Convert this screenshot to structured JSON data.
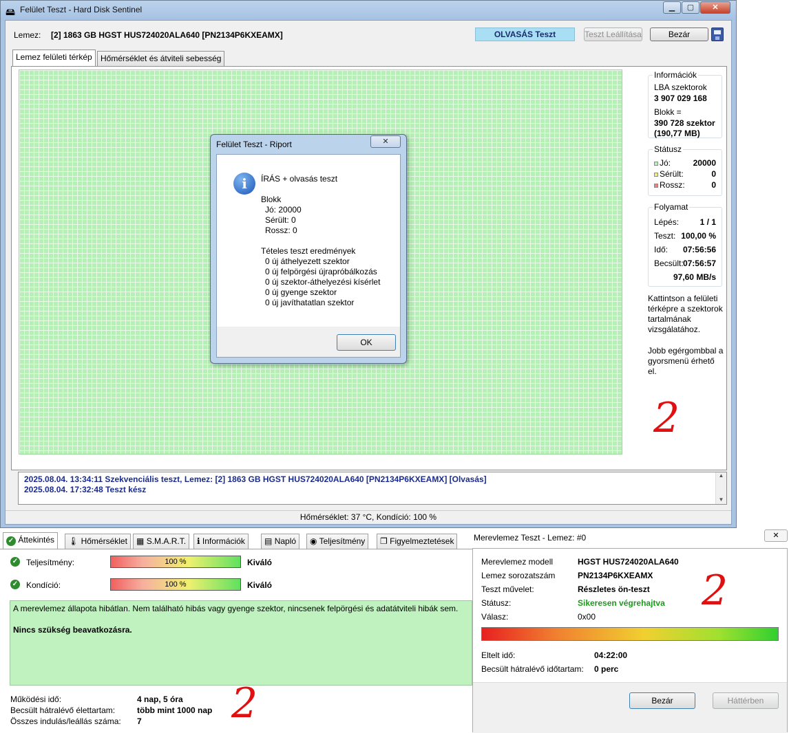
{
  "main_window": {
    "title": "Felület Teszt - Hard Disk Sentinel",
    "controls": {
      "minimize": "▁",
      "maximize": "▢",
      "close": "✕"
    },
    "disk_label": "Lemez:",
    "disk_value": "[2] 1863 GB  HGST HUS724020ALA640 [PN2134P6KXEAMX]",
    "status_button": "OLVASÁS Teszt",
    "stop_button": "Teszt Leállítása",
    "close_button": "Bezár",
    "tabs": [
      "Lemez felületi térkép",
      "Hőmérséklet és átviteli sebesség"
    ],
    "info": {
      "title": "Információk",
      "lba_label": "LBA szektorok",
      "lba_value": "3 907 029 168",
      "block_label": "Blokk =",
      "block_value": "390 728 szektor",
      "block_size": "(190,77 MB)"
    },
    "status": {
      "title": "Státusz",
      "good_label": "Jó:",
      "good_value": "20000",
      "damaged_label": "Sérült:",
      "damaged_value": "0",
      "bad_label": "Rossz:",
      "bad_value": "0"
    },
    "progress": {
      "title": "Folyamat",
      "step_label": "Lépés:",
      "step_value": "1 / 1",
      "test_label": "Teszt:",
      "test_value": "100,00 %",
      "time_label": "Idő:",
      "time_value": "07:56:56",
      "est_label": "Becsült:",
      "est_value": "07:56:57",
      "speed": "97,60 MB/s"
    },
    "hint1": [
      "Kattintson a felületi",
      "térképre a szektorok",
      "tartalmának",
      "vizsgálatához."
    ],
    "hint2": [
      "Jobb egérgombbal a",
      "gyorsmenü érhető",
      "el."
    ],
    "log": [
      "2025.08.04.  13:34:11   Szekvenciális teszt, Lemez: [2] 1863 GB  HGST HUS724020ALA640 [PN2134P6KXEAMX] [Olvasás]",
      "2025.08.04.  17:32:48   Teszt kész"
    ],
    "statusbar": "Hőmérséklet: 37  °C,  Kondíció: 100 %",
    "annotation": "2"
  },
  "report_dialog": {
    "title": "Felület Teszt - Riport",
    "close": "✕",
    "lines": [
      "ÍRÁS + olvasás teszt",
      "",
      "Blokk",
      "  Jó: 20000",
      "  Sérült: 0",
      "  Rossz: 0",
      "",
      "Tételes teszt eredmények",
      "  0 új áthelyezett szektor",
      "  0 új felpörgési újrapróbálkozás",
      "  0 új szektor-áthelyezési kísérlet",
      "  0 új gyenge szektor",
      "  0 új javíthatatlan szektor"
    ],
    "ok_button": "OK"
  },
  "overview_panel": {
    "tabs": [
      "Áttekintés",
      "Hőmérséklet",
      "S.M.A.R.T.",
      "Információk",
      "Napló",
      "Teljesítmény",
      "Figyelmeztetések"
    ],
    "performance_label": "Teljesítmény:",
    "performance_value": "100 %",
    "performance_rating": "Kiváló",
    "condition_label": "Kondíció:",
    "condition_value": "100 %",
    "condition_rating": "Kiváló",
    "message": "A merevlemez állapota hibátlan. Nem található hibás vagy gyenge szektor, nincsenek felpörgési és adatátviteli hibák sem.",
    "message_bold": "Nincs szükség beavatkozásra.",
    "uptime_label": "Működési idő:",
    "uptime_value": "4 nap, 5 óra",
    "lifetime_label": "Becsült hátralévő élettartam:",
    "lifetime_value": "több mint 1000 nap",
    "startstop_label": "Összes indulás/leállás száma:",
    "startstop_value": "7",
    "annotation": "2"
  },
  "selftest_dialog": {
    "title": "Merevlemez Teszt - Lemez: #0",
    "close": "✕",
    "model_label": "Merevlemez modell",
    "model_value": "HGST HUS724020ALA640",
    "serial_label": "Lemez sorozatszám",
    "serial_value": "PN2134P6KXEAMX",
    "op_label": "Teszt művelet:",
    "op_value": "Részletes ön-teszt",
    "status_label": "Státusz:",
    "status_value": "Sikeresen végrehajtva",
    "reply_label": "Válasz:",
    "reply_value": "0x00",
    "elapsed_label": "Eltelt idő:",
    "elapsed_value": "04:22:00",
    "remaining_label": "Becsült hátralévő időtartam:",
    "remaining_value": "0 perc",
    "close_button": "Bezár",
    "background_button": "Háttérben",
    "annotation": "2"
  }
}
